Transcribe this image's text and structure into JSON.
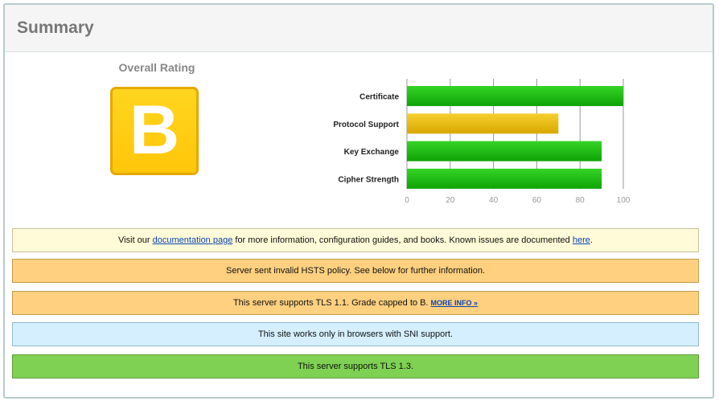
{
  "summary": {
    "title": "Summary",
    "overall_rating_label": "Overall Rating",
    "grade": "B",
    "grade_color": "#ffc60a"
  },
  "chart_data": {
    "type": "bar",
    "orientation": "horizontal",
    "categories": [
      "Certificate",
      "Protocol Support",
      "Key Exchange",
      "Cipher Strength"
    ],
    "values": [
      100,
      70,
      90,
      90
    ],
    "colors": [
      "#1fbd13",
      "#e8b80c",
      "#1fbd13",
      "#1fbd13"
    ],
    "xlim": [
      0,
      100
    ],
    "xticks": [
      0,
      20,
      40,
      60,
      80,
      100
    ],
    "grid": true
  },
  "notices": {
    "info": {
      "prefix": "Visit our ",
      "link1": "documentation page",
      "middle": " for more information, configuration guides, and books. Known issues are documented ",
      "link2": "here",
      "suffix": "."
    },
    "hsts": "Server sent invalid HSTS policy. See below for further information.",
    "tls11": {
      "text": "This server supports TLS 1.1. Grade capped to B. ",
      "link": "MORE INFO »"
    },
    "sni": "This site works only in browsers with SNI support.",
    "tls13": "This server supports TLS 1.3."
  }
}
